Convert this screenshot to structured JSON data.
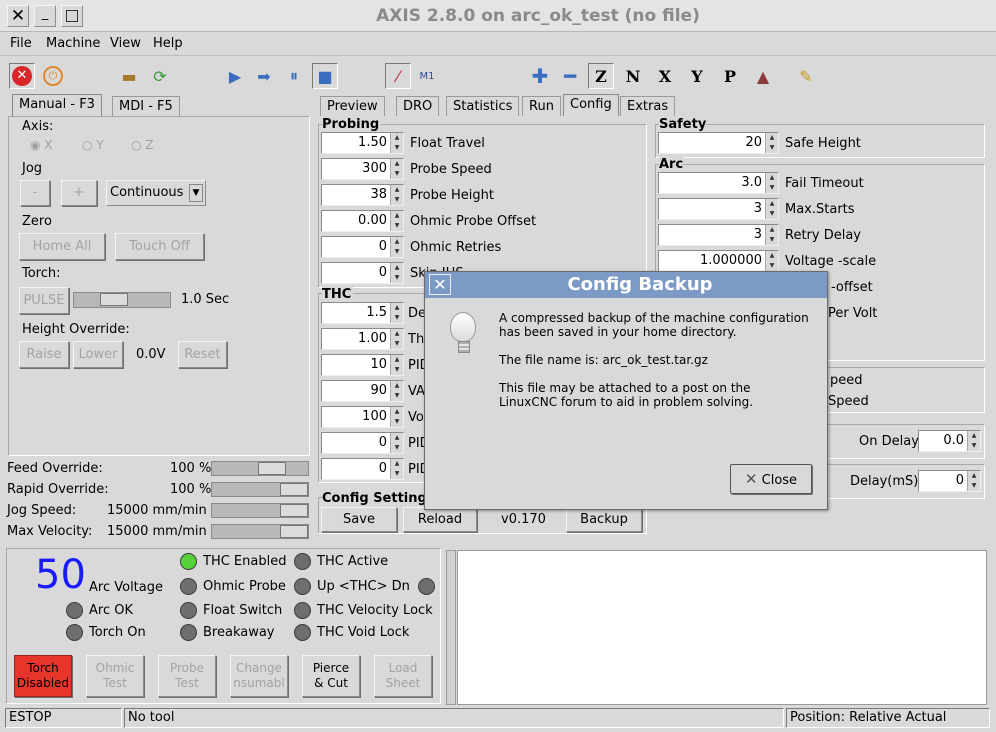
{
  "window": {
    "title": "AXIS 2.8.0 on arc_ok_test (no file)"
  },
  "menu": [
    "File",
    "Machine",
    "View",
    "Help"
  ],
  "left_tabs": [
    "Manual - F3",
    "MDI - F5"
  ],
  "manual": {
    "axis_label": "Axis:",
    "axes": [
      "X",
      "Y",
      "Z"
    ],
    "jog_label": "Jog",
    "jog_minus": "-",
    "jog_plus": "+",
    "jog_mode": "Continuous",
    "zero_label": "Zero",
    "home_all": "Home All",
    "touch_off": "Touch Off",
    "torch_label": "Torch:",
    "pulse": "PULSE",
    "pulse_value": "1.0 Sec",
    "height_label": "Height Override:",
    "raise": "Raise",
    "lower": "Lower",
    "height_value": "0.0V",
    "reset": "Reset"
  },
  "overrides": [
    {
      "label": "Feed Override:",
      "value": "100 %"
    },
    {
      "label": "Rapid Override:",
      "value": "100 %"
    },
    {
      "label": "Jog Speed:",
      "value": "15000 mm/min"
    },
    {
      "label": "Max Velocity:",
      "value": "15000 mm/min"
    }
  ],
  "right_tabs": [
    "Preview",
    "DRO",
    "Statistics",
    "Run",
    "Config",
    "Extras"
  ],
  "probing": {
    "title": "Probing",
    "fields": [
      {
        "value": "1.50",
        "label": "Float Travel"
      },
      {
        "value": "300",
        "label": "Probe Speed"
      },
      {
        "value": "38",
        "label": "Probe Height"
      },
      {
        "value": "0.00",
        "label": "Ohmic Probe Offset"
      },
      {
        "value": "0",
        "label": "Ohmic Retries"
      },
      {
        "value": "0",
        "label": "Skip IHS"
      }
    ]
  },
  "thc": {
    "title": "THC",
    "fields": [
      {
        "value": "1.5",
        "label": "De"
      },
      {
        "value": "1.00",
        "label": "Th"
      },
      {
        "value": "10",
        "label": "PID"
      },
      {
        "value": "90",
        "label": "VA"
      },
      {
        "value": "100",
        "label": "Vo"
      },
      {
        "value": "0",
        "label": "PID"
      },
      {
        "value": "0",
        "label": "PID"
      }
    ]
  },
  "config_settings": {
    "title": "Config Setting",
    "save": "Save",
    "reload": "Reload",
    "version": "v0.170",
    "backup": "Backup"
  },
  "safety": {
    "title": "Safety",
    "value": "20",
    "label": "Safe Height"
  },
  "arc": {
    "title": "Arc",
    "fields": [
      {
        "value": "3.0",
        "label": "Fail Timeout"
      },
      {
        "value": "3",
        "label": "Max.Starts"
      },
      {
        "value": "3",
        "label": "Retry Delay"
      },
      {
        "value": "1.000000",
        "label": "Voltage -scale"
      }
    ],
    "hidden_labels": [
      "-offset",
      "Per Volt"
    ]
  },
  "speed_labels": [
    "peed",
    "Speed"
  ],
  "on_delay": {
    "label": "On Delay",
    "value": "0.0"
  },
  "delay_ms": {
    "label": "Delay(mS)",
    "value": "0"
  },
  "status": {
    "arc_voltage_value": "50",
    "arc_voltage_label": "Arc Voltage",
    "leds": [
      {
        "label": "Arc OK"
      },
      {
        "label": "Torch On"
      },
      {
        "label": "THC Enabled"
      },
      {
        "label": "Ohmic Probe"
      },
      {
        "label": "Float Switch"
      },
      {
        "label": "Breakaway"
      },
      {
        "label": "THC Active"
      },
      {
        "label": "Up  <THC>  Dn"
      },
      {
        "label": "THC Velocity Lock"
      },
      {
        "label": "THC Void Lock"
      }
    ]
  },
  "bottom_buttons": [
    {
      "line1": "Torch",
      "line2": "Disabled"
    },
    {
      "line1": "Ohmic",
      "line2": "Test"
    },
    {
      "line1": "Probe",
      "line2": "Test"
    },
    {
      "line1": "Change",
      "line2": "nsumabl"
    },
    {
      "line1": "Pierce",
      "line2": "& Cut"
    },
    {
      "line1": "Load",
      "line2": "Sheet"
    }
  ],
  "statusbar": {
    "machine": "ESTOP",
    "tool": "No tool",
    "position": "Position: Relative Actual"
  },
  "dialog": {
    "title": "Config Backup",
    "line1": "A compressed backup of the machine configuration",
    "line2": "has been saved in your home directory.",
    "line3": "The file name is: arc_ok_test.tar.gz",
    "line4": "This file may be attached to a post on the",
    "line5": "LinuxCNC forum to aid in problem solving.",
    "close": "Close"
  },
  "colors": {
    "torch_disabled": "#e8352b",
    "dialog_header": "#7d9ac6",
    "arc_value": "#1a1aff"
  }
}
